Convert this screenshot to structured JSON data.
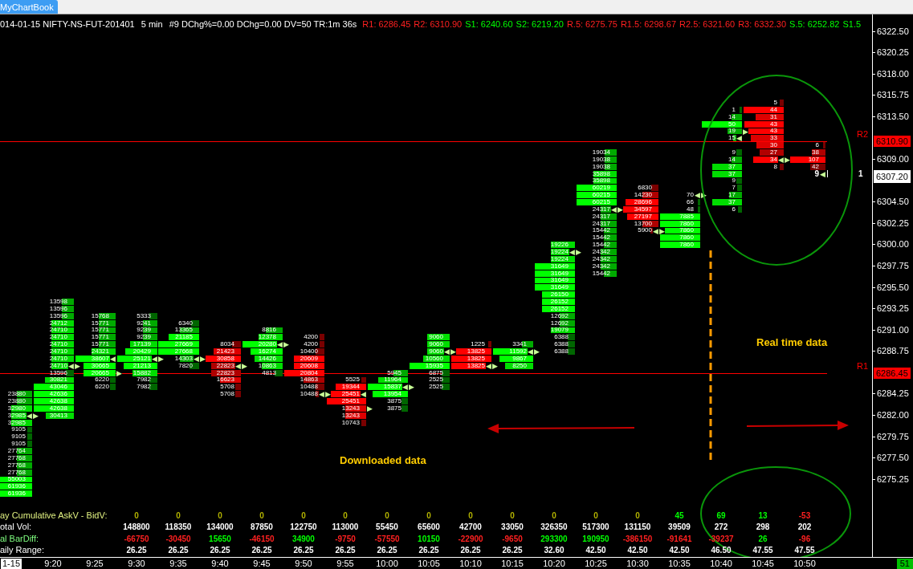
{
  "tab": {
    "label": "MyChartBook",
    "selected": true
  },
  "header": {
    "info": [
      "014-01-15 NIFTY-NS-FUT-201401",
      "5 min",
      "#9 DChg%=0.00 DChg=0.00 DV=50 TR:1m 36s"
    ],
    "pivots": [
      {
        "label": "R1: 6286.45",
        "color": "#ff2020"
      },
      {
        "label": "R2: 6310.90",
        "color": "#ff2020"
      },
      {
        "label": "S1: 6240.60",
        "color": "#00ff00"
      },
      {
        "label": "S2: 6219.20",
        "color": "#00ff00"
      },
      {
        "label": "R.5: 6275.75",
        "color": "#ff2020"
      },
      {
        "label": "R1.5: 6298.67",
        "color": "#ff2020"
      },
      {
        "label": "R2.5: 6321.60",
        "color": "#ff2020"
      },
      {
        "label": "R3: 6332.30",
        "color": "#ff2020"
      },
      {
        "label": "S.5: 6252.82",
        "color": "#00ff00"
      },
      {
        "label": "S1.5",
        "color": "#00ff00"
      }
    ]
  },
  "price_axis": {
    "labels": [
      "6322.50",
      "6320.25",
      "6318.00",
      "6315.75",
      "6313.50",
      "6309.00",
      "6304.50",
      "6302.25",
      "6300.00",
      "6297.75",
      "6295.50",
      "6293.25",
      "6291.00",
      "6288.75",
      "6284.25",
      "6282.00",
      "6279.75",
      "6277.50",
      "6275.25"
    ]
  },
  "levels": [
    {
      "name": "R2",
      "price": "6310.90",
      "color": "#ff0000"
    },
    {
      "name": "R1",
      "price": "6286.45",
      "color": "#ff0000"
    }
  ],
  "last_price": {
    "price": "6307.20",
    "label": "1"
  },
  "footprint": {
    "columns": [
      {
        "cells": [
          {
            "value": "23880"
          },
          {
            "value": "23880"
          },
          {
            "value": "32980"
          },
          {
            "value": "32985",
            "marker_in": "◀",
            "marker_out": "▶"
          },
          {
            "value": "32985"
          },
          {
            "value": "9105"
          },
          {
            "value": "9105"
          },
          {
            "value": "9105"
          },
          {
            "value": "27764"
          },
          {
            "value": "27768"
          },
          {
            "value": "27768"
          },
          {
            "value": "27768"
          },
          {
            "value": "55003"
          },
          {
            "value": "61936"
          },
          {
            "value": "61936"
          }
        ]
      },
      {
        "cells": [
          {
            "value": "13598"
          },
          {
            "value": "13596"
          },
          {
            "value": "13596"
          },
          {
            "value": "24712"
          },
          {
            "value": "24710"
          },
          {
            "value": "24710"
          },
          {
            "value": "24710"
          },
          {
            "value": "24710"
          },
          {
            "value": "24710"
          },
          {
            "value": "24710",
            "marker_in": "◀",
            "marker_out": "▶"
          },
          {
            "value": "13596"
          },
          {
            "value": "30821"
          },
          {
            "value": "43046"
          },
          {
            "value": "42636"
          },
          {
            "value": "42638"
          },
          {
            "value": "42638"
          },
          {
            "value": "30413"
          }
        ]
      },
      {
        "cells": [
          {
            "value": "15768"
          },
          {
            "value": "15771"
          },
          {
            "value": "15771"
          },
          {
            "value": "15771"
          },
          {
            "value": "15771"
          },
          {
            "value": "24321"
          },
          {
            "value": "38607",
            "marker_in": "◀"
          },
          {
            "value": "30665"
          },
          {
            "value": "20665",
            "marker_out": "▶"
          },
          {
            "value": "6220"
          },
          {
            "value": "6220"
          }
        ]
      },
      {
        "cells": [
          {
            "value": "5333"
          },
          {
            "value": "9241"
          },
          {
            "value": "9239"
          },
          {
            "value": "9239"
          },
          {
            "value": "17139"
          },
          {
            "value": "20429"
          },
          {
            "value": "25121",
            "marker_in": "◀",
            "marker_out": "▶"
          },
          {
            "value": "21213"
          },
          {
            "value": "15882"
          },
          {
            "value": "7982"
          },
          {
            "value": "7982"
          }
        ]
      },
      {
        "cells": [
          {
            "value": "6340"
          },
          {
            "value": "13365"
          },
          {
            "value": "21185"
          },
          {
            "value": "27669"
          },
          {
            "value": "27668"
          },
          {
            "value": "14303",
            "marker_in": "◀",
            "marker_out": "▶"
          },
          {
            "value": "7820"
          }
        ]
      },
      {
        "cells": [
          {
            "value": "8034"
          },
          {
            "value": "21423"
          },
          {
            "value": "30858"
          },
          {
            "value": "22823",
            "marker_in": "◀",
            "marker_out": "▶"
          },
          {
            "value": "22823"
          },
          {
            "value": "16623"
          },
          {
            "value": "5708"
          },
          {
            "value": "5708"
          }
        ]
      },
      {
        "cells": [
          {
            "value": "8816"
          },
          {
            "value": "12378"
          },
          {
            "value": "20280",
            "marker_in": "◀",
            "marker_out": "▶"
          },
          {
            "value": "16274"
          },
          {
            "value": "14426"
          },
          {
            "value": "10863"
          },
          {
            "value": "4813"
          }
        ]
      },
      {
        "cells": [
          {
            "value": "4200"
          },
          {
            "value": "4200"
          },
          {
            "value": "10400"
          },
          {
            "value": "20609"
          },
          {
            "value": "20608"
          },
          {
            "value": "20804"
          },
          {
            "value": "14863"
          },
          {
            "value": "10488"
          },
          {
            "value": "10488",
            "marker_in": "◀",
            "marker_out": "▶"
          }
        ]
      },
      {
        "cells": [
          {
            "value": "5525"
          },
          {
            "value": "19344"
          },
          {
            "value": "25451",
            "marker_in": "◀"
          },
          {
            "value": "25451"
          },
          {
            "value": "13243",
            "marker_out": "▶"
          },
          {
            "value": "13243"
          },
          {
            "value": "10743"
          }
        ]
      },
      {
        "cells": [
          {
            "value": "5945"
          },
          {
            "value": "11964"
          },
          {
            "value": "15837",
            "marker_in": "◀",
            "marker_out": "▶"
          },
          {
            "value": "13954"
          },
          {
            "value": "3875"
          },
          {
            "value": "3875"
          }
        ]
      },
      {
        "cells": [
          {
            "value": "9060"
          },
          {
            "value": "9060"
          },
          {
            "value": "9060",
            "marker_in": "◀",
            "marker_out": "▶"
          },
          {
            "value": "10560"
          },
          {
            "value": "15935"
          },
          {
            "value": "6875"
          },
          {
            "value": "2525"
          },
          {
            "value": "2525"
          }
        ]
      },
      {
        "cells": [
          {
            "value": "1225"
          },
          {
            "value": "13825"
          },
          {
            "value": "13825"
          },
          {
            "value": "13825",
            "marker_in": "◀",
            "marker_out": "▶"
          }
        ]
      },
      {
        "cells": [
          {
            "value": "3341"
          },
          {
            "value": "11592",
            "marker_in": "◀",
            "marker_out": "▶"
          },
          {
            "value": "9867"
          },
          {
            "value": "8250"
          }
        ]
      },
      {
        "cells": [
          {
            "value": "19226"
          },
          {
            "value": "19224",
            "marker_in": "◀",
            "marker_out": "▶"
          },
          {
            "value": "19224"
          },
          {
            "value": "31649"
          },
          {
            "value": "31649"
          },
          {
            "value": "31649"
          },
          {
            "value": "31649"
          },
          {
            "value": "26150"
          },
          {
            "value": "26152"
          },
          {
            "value": "26152"
          },
          {
            "value": "12692"
          },
          {
            "value": "12692"
          },
          {
            "value": "19079"
          },
          {
            "value": "6388"
          },
          {
            "value": "6388"
          },
          {
            "value": "6388"
          }
        ]
      },
      {
        "cells": [
          {
            "value": "19034"
          },
          {
            "value": "19038"
          },
          {
            "value": "19038"
          },
          {
            "value": "35898"
          },
          {
            "value": "35898"
          },
          {
            "value": "60219"
          },
          {
            "value": "60215"
          },
          {
            "value": "60215"
          },
          {
            "value": "24317",
            "marker_in": "◀",
            "marker_out": "▶"
          },
          {
            "value": "24317"
          },
          {
            "value": "24317"
          },
          {
            "value": "15442"
          },
          {
            "value": "15442"
          },
          {
            "value": "15442"
          },
          {
            "value": "24342"
          },
          {
            "value": "24342"
          },
          {
            "value": "24342"
          },
          {
            "value": "15442"
          }
        ]
      },
      {
        "cells": [
          {
            "value": "6830"
          },
          {
            "value": "14230"
          },
          {
            "value": "28696"
          },
          {
            "value": "34597"
          },
          {
            "value": "27197"
          },
          {
            "value": "13700"
          },
          {
            "value": "5900",
            "marker_in": "◀",
            "marker_out": "▶"
          }
        ]
      },
      {
        "cells": [
          {
            "value": "70",
            "marker_in": "◀",
            "marker_out": "▶"
          },
          {
            "value": "66"
          },
          {
            "value": "48"
          },
          {
            "value": "7885"
          },
          {
            "value": "7860"
          },
          {
            "value": "7860"
          },
          {
            "value": "7860"
          },
          {
            "value": "7860"
          }
        ]
      },
      {
        "cells": [
          {
            "value": "1"
          },
          {
            "value": "14"
          },
          {
            "value": "50"
          },
          {
            "value": "19",
            "marker_out": "▶"
          },
          {
            "value": "15",
            "marker_in": "◀"
          },
          {
            "value": "9"
          },
          {
            "value": "14"
          },
          {
            "value": "37"
          },
          {
            "value": "37"
          },
          {
            "value": "9"
          },
          {
            "value": "7"
          },
          {
            "value": "17"
          },
          {
            "value": "37"
          },
          {
            "value": "6"
          }
        ]
      },
      {
        "cells": [
          {
            "value": "5"
          },
          {
            "value": "44"
          },
          {
            "value": "31"
          },
          {
            "value": "43"
          },
          {
            "value": "43"
          },
          {
            "value": "33"
          },
          {
            "value": "30"
          },
          {
            "value": "27"
          },
          {
            "value": "34",
            "marker_in": "◀",
            "marker_out": "▶"
          },
          {
            "value": "8"
          }
        ]
      },
      {
        "cells": [
          {
            "value": "6"
          },
          {
            "value": "38"
          },
          {
            "value": "107"
          },
          {
            "value": "42"
          }
        ]
      }
    ],
    "last_trade": {
      "value": "9",
      "marker_in": "◀"
    }
  },
  "annotations": [
    "Real time data",
    "Downloaded data"
  ],
  "stats": [
    {
      "label": "ay Cumulative AskV - BidV:",
      "color": "#e0f080",
      "values": [
        {
          "text": "0",
          "color": "#b0b000"
        },
        {
          "text": "0",
          "color": "#b0b000"
        },
        {
          "text": "0",
          "color": "#b0b000"
        },
        {
          "text": "0",
          "color": "#b0b000"
        },
        {
          "text": "0",
          "color": "#b0b000"
        },
        {
          "text": "0",
          "color": "#b0b000"
        },
        {
          "text": "0",
          "color": "#b0b000"
        },
        {
          "text": "0",
          "color": "#b0b000"
        },
        {
          "text": "0",
          "color": "#b0b000"
        },
        {
          "text": "0",
          "color": "#b0b000"
        },
        {
          "text": "0",
          "color": "#b0b000"
        },
        {
          "text": "0",
          "color": "#b0b000"
        },
        {
          "text": "0",
          "color": "#b0b000"
        },
        {
          "text": "45",
          "color": "#00ff00"
        },
        {
          "text": "69",
          "color": "#00ff00"
        },
        {
          "text": "13",
          "color": "#00ff00"
        },
        {
          "text": "-53",
          "color": "#ff2020"
        }
      ]
    },
    {
      "label": "otal Vol:",
      "color": "#ffffff",
      "values": [
        "148800",
        "118350",
        "134000",
        "87850",
        "122750",
        "113000",
        "55450",
        "65600",
        "42700",
        "33050",
        "326350",
        "517300",
        "131150",
        "39509",
        "272",
        "298",
        "202"
      ]
    },
    {
      "label": "al BarDiff:",
      "color": "#80ff80",
      "values": [
        {
          "text": "-66750",
          "color": "#ff2020"
        },
        {
          "text": "-30450",
          "color": "#ff2020"
        },
        {
          "text": "15650",
          "color": "#00ff00"
        },
        {
          "text": "-46150",
          "color": "#ff2020"
        },
        {
          "text": "34900",
          "color": "#00ff00"
        },
        {
          "text": "-9750",
          "color": "#ff2020"
        },
        {
          "text": "-57550",
          "color": "#ff2020"
        },
        {
          "text": "10150",
          "color": "#00ff00"
        },
        {
          "text": "-22900",
          "color": "#ff2020"
        },
        {
          "text": "-9650",
          "color": "#ff2020"
        },
        {
          "text": "293300",
          "color": "#00ff00"
        },
        {
          "text": "190950",
          "color": "#00ff00"
        },
        {
          "text": "-386150",
          "color": "#ff2020"
        },
        {
          "text": "-91641",
          "color": "#ff2020"
        },
        {
          "text": "-39237",
          "color": "#ff2020"
        },
        {
          "text": "26",
          "color": "#00ff00"
        },
        {
          "text": "-96",
          "color": "#ff2020"
        }
      ]
    },
    {
      "label": "aily Range:",
      "color": "#ffffff",
      "values": [
        "26.25",
        "26.25",
        "26.25",
        "26.25",
        "26.25",
        "26.25",
        "26.25",
        "26.25",
        "26.25",
        "26.25",
        "32.60",
        "42.50",
        "42.50",
        "42.50",
        "46.50",
        "47.55",
        "47.55"
      ]
    }
  ],
  "time_axis": [
    {
      "label": "1-15",
      "highlighted": true
    },
    {
      "label": "9:20",
      "highlighted": false
    },
    {
      "label": "9:25",
      "highlighted": false
    },
    {
      "label": "9:30",
      "highlighted": false
    },
    {
      "label": "9:35",
      "highlighted": false
    },
    {
      "label": "9:40",
      "highlighted": false
    },
    {
      "label": "9:45",
      "highlighted": false
    },
    {
      "label": "9:50",
      "highlighted": false
    },
    {
      "label": "9:55",
      "highlighted": false
    },
    {
      "label": "10:00",
      "highlighted": false
    },
    {
      "label": "10:05",
      "highlighted": false
    },
    {
      "label": "10:10",
      "highlighted": false
    },
    {
      "label": "10:15",
      "highlighted": false
    },
    {
      "label": "10:20",
      "highlighted": false
    },
    {
      "label": "10:25",
      "highlighted": false
    },
    {
      "label": "10:30",
      "highlighted": false
    },
    {
      "label": "10:35",
      "highlighted": false
    },
    {
      "label": "10:40",
      "highlighted": false
    },
    {
      "label": "10:45",
      "highlighted": false
    },
    {
      "label": "10:50",
      "highlighted": false
    }
  ],
  "bar_count": "51"
}
